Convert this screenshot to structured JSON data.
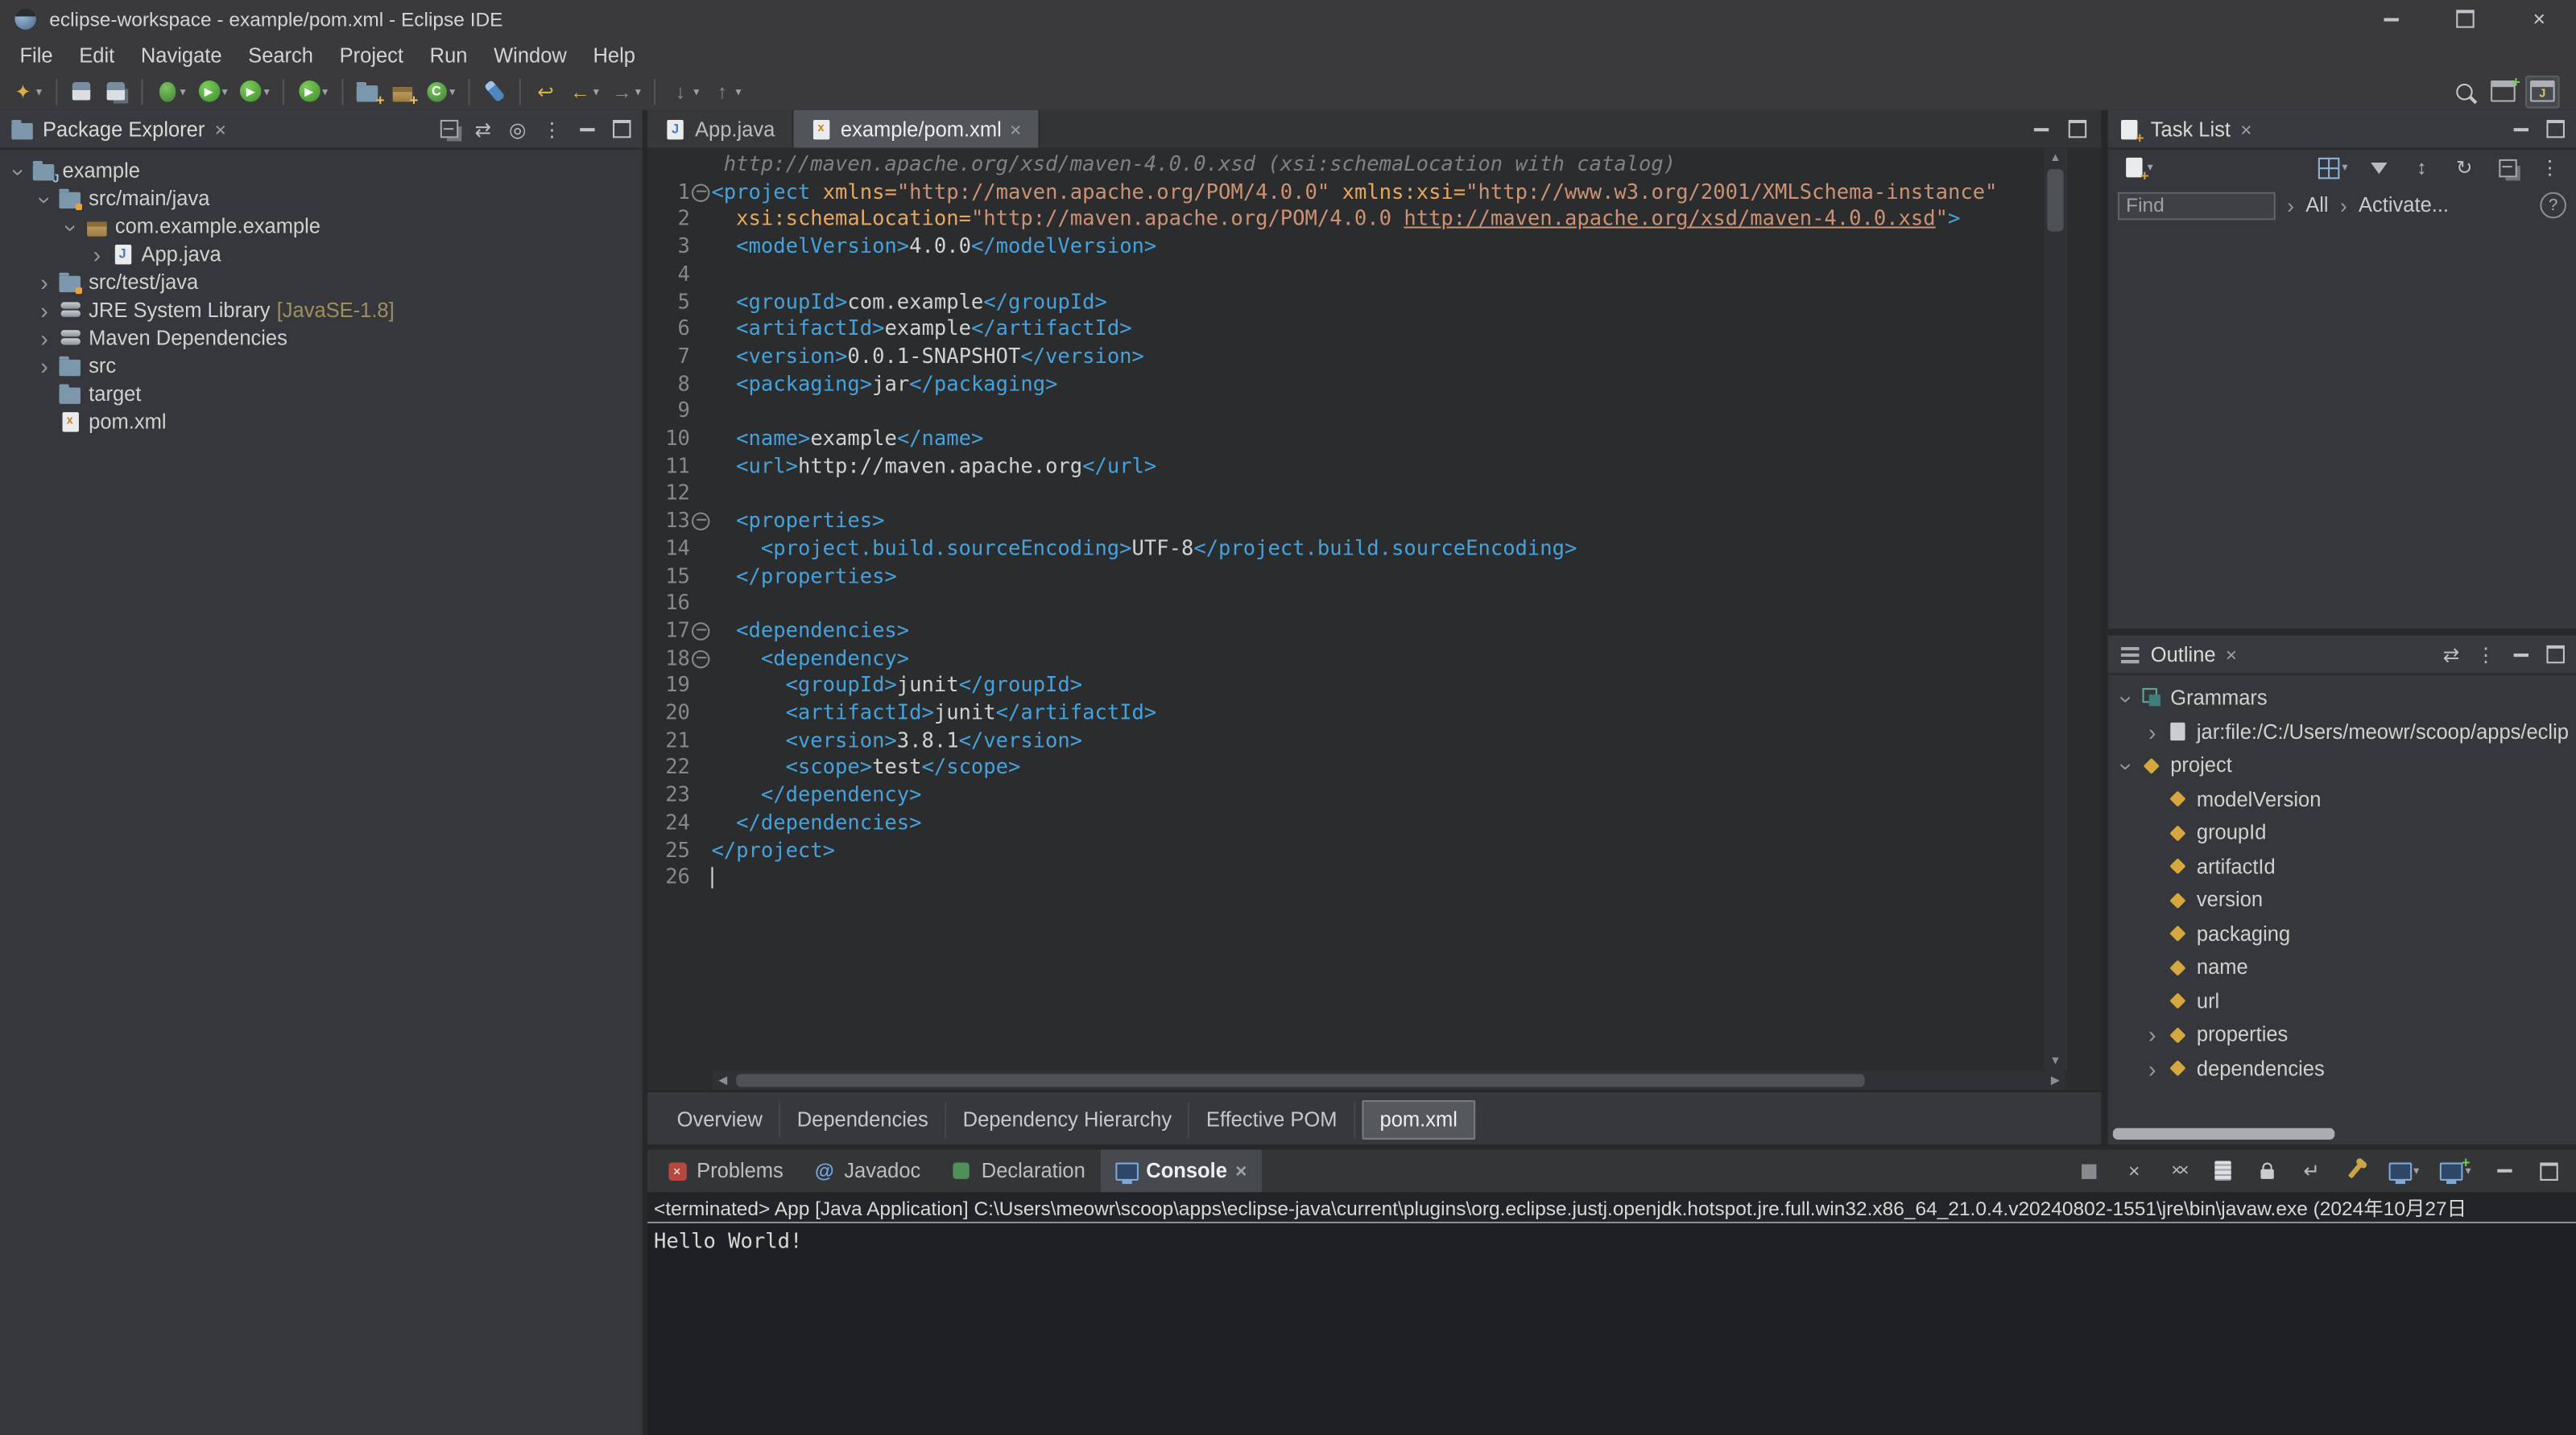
{
  "colors": {
    "tag": "#45a2dc",
    "attribute": "#e8a75f",
    "value": "#cd9273",
    "plain": "#cfd1d3",
    "annotation": "#7e8287",
    "line_number": "#85888c",
    "javase_suffix": "#9e8f62",
    "console_text": "#d6d8da"
  },
  "window": {
    "title": "eclipse-workspace - example/pom.xml - Eclipse IDE"
  },
  "menubar": [
    "File",
    "Edit",
    "Navigate",
    "Search",
    "Project",
    "Run",
    "Window",
    "Help"
  ],
  "toolbar": {
    "left": [
      {
        "icon": "new-wizard",
        "caret": true
      },
      {
        "sep": true
      },
      {
        "icon": "save"
      },
      {
        "icon": "save-all"
      },
      {
        "sep": true
      },
      {
        "icon": "debug",
        "caret": true
      },
      {
        "icon": "run",
        "caret": true
      },
      {
        "icon": "run-external-tools",
        "caret": true
      },
      {
        "sep": true
      },
      {
        "icon": "coverage",
        "caret": true
      },
      {
        "sep": true
      },
      {
        "icon": "new-java-project"
      },
      {
        "icon": "new-java-package"
      },
      {
        "icon": "new-java-class",
        "caret": true
      },
      {
        "sep": true
      },
      {
        "icon": "search"
      },
      {
        "sep": true
      },
      {
        "icon": "last-edit-location"
      },
      {
        "icon": "back",
        "caret": true
      },
      {
        "icon": "forward",
        "caret": true
      },
      {
        "sep": true
      },
      {
        "icon": "next-annotation",
        "caret": true
      },
      {
        "icon": "previous-annotation",
        "caret": true
      }
    ],
    "right": [
      {
        "icon": "quick-search"
      },
      {
        "icon": "open-perspective"
      },
      {
        "icon": "java-perspective",
        "active": true
      }
    ]
  },
  "package_explorer": {
    "title": "Package Explorer",
    "header_icons": [
      "collapse-all",
      "link-with-editor",
      "focus-on-active-task",
      "view-menu",
      "minimize",
      "maximize"
    ],
    "items": [
      {
        "label": "example",
        "depth": 0,
        "state": "expanded",
        "icon": "java-project"
      },
      {
        "label": "src/main/java",
        "depth": 1,
        "state": "expanded",
        "icon": "source-folder"
      },
      {
        "label": "com.example.example",
        "depth": 2,
        "state": "expanded",
        "icon": "package"
      },
      {
        "label": "App.java",
        "depth": 3,
        "state": "collapsed",
        "icon": "java-file"
      },
      {
        "label": "src/test/java",
        "depth": 1,
        "state": "collapsed",
        "icon": "source-folder"
      },
      {
        "label": "JRE System Library",
        "suffix": "[JavaSE-1.8]",
        "depth": 1,
        "state": "collapsed",
        "icon": "library"
      },
      {
        "label": "Maven Dependencies",
        "depth": 1,
        "state": "collapsed",
        "icon": "library"
      },
      {
        "label": "src",
        "depth": 1,
        "state": "collapsed",
        "icon": "folder"
      },
      {
        "label": "target",
        "depth": 1,
        "state": "leaf",
        "icon": "folder"
      },
      {
        "label": "pom.xml",
        "depth": 1,
        "state": "leaf",
        "icon": "xml-file"
      }
    ]
  },
  "editor": {
    "tabs": [
      {
        "label": "App.java",
        "icon": "java-file",
        "active": false,
        "closable": false
      },
      {
        "label": "example/pom.xml",
        "icon": "xml-file",
        "active": true,
        "closable": true
      }
    ],
    "annotation": "http://maven.apache.org/xsd/maven-4.0.0.xsd (xsi:schemaLocation with catalog)",
    "lines": [
      {
        "n": 1,
        "fold": true,
        "seg": [
          [
            "tag",
            "<project"
          ],
          [
            "pl",
            " "
          ],
          [
            "attr",
            "xmlns="
          ],
          [
            "val",
            "\"http://maven.apache.org/POM/4.0.0\""
          ],
          [
            "pl",
            " "
          ],
          [
            "attr",
            "xmlns:xsi="
          ],
          [
            "val",
            "\"http://www.w3.org/2001/XMLSchema-instance\""
          ]
        ]
      },
      {
        "n": 2,
        "seg": [
          [
            "pl",
            "  "
          ],
          [
            "attr",
            "xsi:schemaLocation="
          ],
          [
            "val",
            "\"http://maven.apache.org/POM/4.0.0 "
          ],
          [
            "link",
            "http://maven.apache.org/xsd/maven-4.0.0.xsd"
          ],
          [
            "val",
            "\""
          ],
          [
            "tag",
            ">"
          ]
        ]
      },
      {
        "n": 3,
        "seg": [
          [
            "pl",
            "  "
          ],
          [
            "tag",
            "<modelVersion>"
          ],
          [
            "pl",
            "4.0.0"
          ],
          [
            "tag",
            "</modelVersion>"
          ]
        ]
      },
      {
        "n": 4,
        "seg": []
      },
      {
        "n": 5,
        "seg": [
          [
            "pl",
            "  "
          ],
          [
            "tag",
            "<groupId>"
          ],
          [
            "pl",
            "com.example"
          ],
          [
            "tag",
            "</groupId>"
          ]
        ]
      },
      {
        "n": 6,
        "seg": [
          [
            "pl",
            "  "
          ],
          [
            "tag",
            "<artifactId>"
          ],
          [
            "pl",
            "example"
          ],
          [
            "tag",
            "</artifactId>"
          ]
        ]
      },
      {
        "n": 7,
        "seg": [
          [
            "pl",
            "  "
          ],
          [
            "tag",
            "<version>"
          ],
          [
            "pl",
            "0.0.1-SNAPSHOT"
          ],
          [
            "tag",
            "</version>"
          ]
        ]
      },
      {
        "n": 8,
        "seg": [
          [
            "pl",
            "  "
          ],
          [
            "tag",
            "<packaging>"
          ],
          [
            "pl",
            "jar"
          ],
          [
            "tag",
            "</packaging>"
          ]
        ]
      },
      {
        "n": 9,
        "seg": []
      },
      {
        "n": 10,
        "seg": [
          [
            "pl",
            "  "
          ],
          [
            "tag",
            "<name>"
          ],
          [
            "pl",
            "example"
          ],
          [
            "tag",
            "</name>"
          ]
        ]
      },
      {
        "n": 11,
        "seg": [
          [
            "pl",
            "  "
          ],
          [
            "tag",
            "<url>"
          ],
          [
            "pl",
            "http://maven.apache.org"
          ],
          [
            "tag",
            "</url>"
          ]
        ]
      },
      {
        "n": 12,
        "seg": []
      },
      {
        "n": 13,
        "fold": true,
        "seg": [
          [
            "pl",
            "  "
          ],
          [
            "tag",
            "<properties>"
          ]
        ]
      },
      {
        "n": 14,
        "seg": [
          [
            "pl",
            "    "
          ],
          [
            "tag",
            "<project.build.sourceEncoding>"
          ],
          [
            "pl",
            "UTF-8"
          ],
          [
            "tag",
            "</project.build.sourceEncoding>"
          ]
        ]
      },
      {
        "n": 15,
        "seg": [
          [
            "pl",
            "  "
          ],
          [
            "tag",
            "</properties>"
          ]
        ]
      },
      {
        "n": 16,
        "seg": []
      },
      {
        "n": 17,
        "fold": true,
        "seg": [
          [
            "pl",
            "  "
          ],
          [
            "tag",
            "<dependencies>"
          ]
        ]
      },
      {
        "n": 18,
        "fold": true,
        "seg": [
          [
            "pl",
            "    "
          ],
          [
            "tag",
            "<dependency>"
          ]
        ]
      },
      {
        "n": 19,
        "seg": [
          [
            "pl",
            "      "
          ],
          [
            "tag",
            "<groupId>"
          ],
          [
            "pl",
            "junit"
          ],
          [
            "tag",
            "</groupId>"
          ]
        ]
      },
      {
        "n": 20,
        "seg": [
          [
            "pl",
            "      "
          ],
          [
            "tag",
            "<artifactId>"
          ],
          [
            "pl",
            "junit"
          ],
          [
            "tag",
            "</artifactId>"
          ]
        ]
      },
      {
        "n": 21,
        "seg": [
          [
            "pl",
            "      "
          ],
          [
            "tag",
            "<version>"
          ],
          [
            "pl",
            "3.8.1"
          ],
          [
            "tag",
            "</version>"
          ]
        ]
      },
      {
        "n": 22,
        "seg": [
          [
            "pl",
            "      "
          ],
          [
            "tag",
            "<scope>"
          ],
          [
            "pl",
            "test"
          ],
          [
            "tag",
            "</scope>"
          ]
        ]
      },
      {
        "n": 23,
        "seg": [
          [
            "pl",
            "    "
          ],
          [
            "tag",
            "</dependency>"
          ]
        ]
      },
      {
        "n": 24,
        "seg": [
          [
            "pl",
            "  "
          ],
          [
            "tag",
            "</dependencies>"
          ]
        ]
      },
      {
        "n": 25,
        "seg": [
          [
            "tag",
            "</project>"
          ]
        ]
      },
      {
        "n": 26,
        "cursor": true,
        "seg": []
      }
    ],
    "bottom_tabs": [
      "Overview",
      "Dependencies",
      "Dependency Hierarchy",
      "Effective POM",
      "pom.xml"
    ],
    "active_bottom_tab": "pom.xml"
  },
  "task_list": {
    "title": "Task List",
    "header_icons": [
      "minimize",
      "maximize"
    ],
    "toolbar_icons_left": [
      {
        "icon": "new-task",
        "caret": true
      }
    ],
    "toolbar_icons_right": [
      {
        "icon": "categorized",
        "caret": true
      },
      {
        "icon": "filter"
      },
      {
        "icon": "sort"
      },
      {
        "icon": "synchronize"
      },
      {
        "icon": "collapse-all"
      },
      {
        "icon": "view-menu"
      }
    ],
    "find_placeholder": "Find",
    "scope_all_label": "All",
    "activate_label": "Activate...",
    "help_glyph": "?"
  },
  "outline": {
    "title": "Outline",
    "header_icons": [
      "link-with-editor",
      "view-menu",
      "minimize",
      "maximize"
    ],
    "items": [
      {
        "label": "Grammars",
        "depth": 0,
        "state": "expanded",
        "icon": "grammars"
      },
      {
        "label": "jar:file:/C:/Users/meowr/scoop/apps/eclip",
        "depth": 1,
        "state": "collapsed",
        "icon": "catalog"
      },
      {
        "label": "project",
        "depth": 0,
        "state": "expanded",
        "icon": "element"
      },
      {
        "label": "modelVersion",
        "depth": 1,
        "state": "leaf",
        "icon": "element"
      },
      {
        "label": "groupId",
        "depth": 1,
        "state": "leaf",
        "icon": "element"
      },
      {
        "label": "artifactId",
        "depth": 1,
        "state": "leaf",
        "icon": "element"
      },
      {
        "label": "version",
        "depth": 1,
        "state": "leaf",
        "icon": "element"
      },
      {
        "label": "packaging",
        "depth": 1,
        "state": "leaf",
        "icon": "element"
      },
      {
        "label": "name",
        "depth": 1,
        "state": "leaf",
        "icon": "element"
      },
      {
        "label": "url",
        "depth": 1,
        "state": "leaf",
        "icon": "element"
      },
      {
        "label": "properties",
        "depth": 1,
        "state": "collapsed",
        "icon": "element"
      },
      {
        "label": "dependencies",
        "depth": 1,
        "state": "collapsed",
        "icon": "element"
      }
    ]
  },
  "console": {
    "tabs": [
      {
        "label": "Problems",
        "icon": "problems",
        "active": false,
        "closable": false
      },
      {
        "label": "Javadoc",
        "icon": "javadoc",
        "active": false,
        "closable": false
      },
      {
        "label": "Declaration",
        "icon": "declaration",
        "active": false,
        "closable": false
      },
      {
        "label": "Console",
        "icon": "console",
        "active": true,
        "closable": true
      }
    ],
    "toolbar_icons": [
      {
        "icon": "terminate"
      },
      {
        "icon": "remove-launch"
      },
      {
        "icon": "remove-all-launches"
      },
      {
        "icon": "clear-console"
      },
      {
        "icon": "scroll-lock"
      },
      {
        "icon": "word-wrap"
      },
      {
        "icon": "pin-console"
      },
      {
        "icon": "display-selected-console",
        "caret": true
      },
      {
        "icon": "open-console",
        "caret": true
      },
      {
        "icon": "minimize"
      },
      {
        "icon": "maximize"
      }
    ],
    "banner": "<terminated> App [Java Application] C:\\Users\\meowr\\scoop\\apps\\eclipse-java\\current\\plugins\\org.eclipse.justj.openjdk.hotspot.jre.full.win32.x86_64_21.0.4.v20240802-1551\\jre\\bin\\javaw.exe (2024年10月27日",
    "output": "Hello World!"
  }
}
